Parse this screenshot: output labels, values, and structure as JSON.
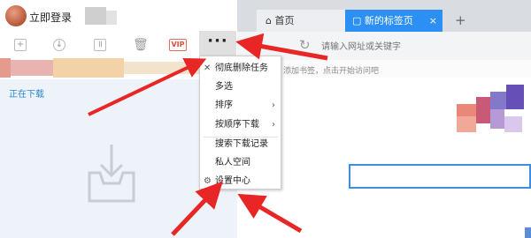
{
  "app": {
    "login_label": "立即登录"
  },
  "downloads": {
    "toolbar": {
      "vip_label": "VIP",
      "more_label": "···"
    },
    "side_item": "正在下载"
  },
  "browser": {
    "tabs": [
      {
        "label": "首页",
        "icon": "home-icon"
      },
      {
        "label": "新的标签页",
        "icon": "page-icon",
        "active": true
      }
    ],
    "new_tab": "+",
    "address_placeholder": "请输入网址或关键字",
    "bookmark_hint": "添加书签，点击开始访问吧"
  },
  "menu": {
    "items": [
      {
        "label": "彻底删除任务",
        "icon": "close-icon"
      },
      {
        "label": "多选"
      },
      {
        "label": "排序",
        "submenu": true
      },
      {
        "label": "按顺序下载",
        "submenu": true
      },
      {
        "label": "搜索下载记录"
      },
      {
        "label": "私人空间"
      },
      {
        "label": "设置中心",
        "icon": "gear-icon"
      }
    ]
  },
  "colors": {
    "accent": "#2b8ff3",
    "arrow": "#e82626",
    "selection": "#e0e0e0"
  }
}
